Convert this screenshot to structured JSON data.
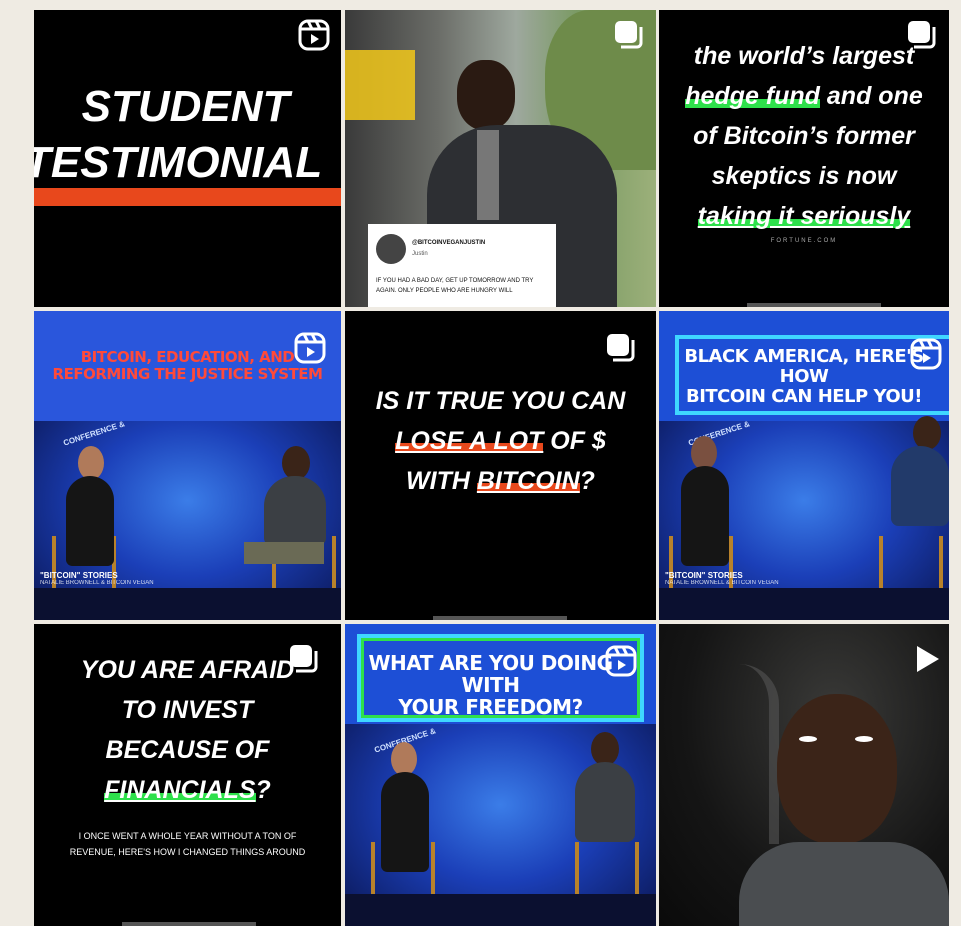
{
  "tiles": {
    "t1": {
      "line1": "STUDENT",
      "line2": "TESTIMONIAL"
    },
    "t2": {
      "handle": "@BITCOINVEGANJUSTIN",
      "name": "Justin",
      "quote": "IF YOU HAD A BAD DAY, GET UP TOMORROW AND TRY AGAIN. ONLY PEOPLE WHO ARE HUNGRY WILL"
    },
    "t3": {
      "l1": "the world’s largest",
      "l2a": "hedge fund",
      "l2b": " and one",
      "l3": "of Bitcoin’s former",
      "l4": "skeptics is now",
      "l5": "taking it seriously",
      "source": "FORTUNE.COM"
    },
    "t4": {
      "title": "BITCOIN, EDUCATION, AND REFORMING THE JUSTICE SYSTEM",
      "badge": "CONFERENCE &",
      "caption": "\"BITCOIN\" STORIES",
      "sub": "NATALIE BROWNELL & BITCOIN VEGAN"
    },
    "t5": {
      "l1": "IS IT TRUE YOU CAN",
      "l2": "LOSE A LOT",
      "l2b": " OF $",
      "l3a": "WITH ",
      "l3b": "BITCOIN",
      "l3c": "?"
    },
    "t6": {
      "title1": "BLACK AMERICA, HERE'S HOW",
      "title2": "BITCOIN CAN HELP YOU!",
      "badge": "CONFERENCE &",
      "caption": "\"BITCOIN\" STORIES",
      "sub": "NATALIE BROWNELL & BITCOIN VEGAN"
    },
    "t7": {
      "l1": "YOU ARE AFRAID",
      "l2": "TO INVEST",
      "l3": "BECAUSE OF",
      "l4": "FINANCIALS",
      "l4b": "?",
      "body": "I ONCE WENT A WHOLE YEAR WITHOUT A TON OF REVENUE, HERE'S HOW I CHANGED THINGS AROUND"
    },
    "t8": {
      "title1": "WHAT ARE YOU DOING WITH",
      "title2": "YOUR FREEDOM?",
      "badge": "CONFERENCE &"
    },
    "t9": {}
  },
  "icons": {
    "reel": "reels-icon",
    "carousel": "carousel-icon",
    "video": "play-icon"
  },
  "colors": {
    "accent_red": "#e8481c",
    "accent_green": "#2ee04b",
    "stage_blue": "#1d4fd6",
    "title_red": "#ff4a3a"
  }
}
